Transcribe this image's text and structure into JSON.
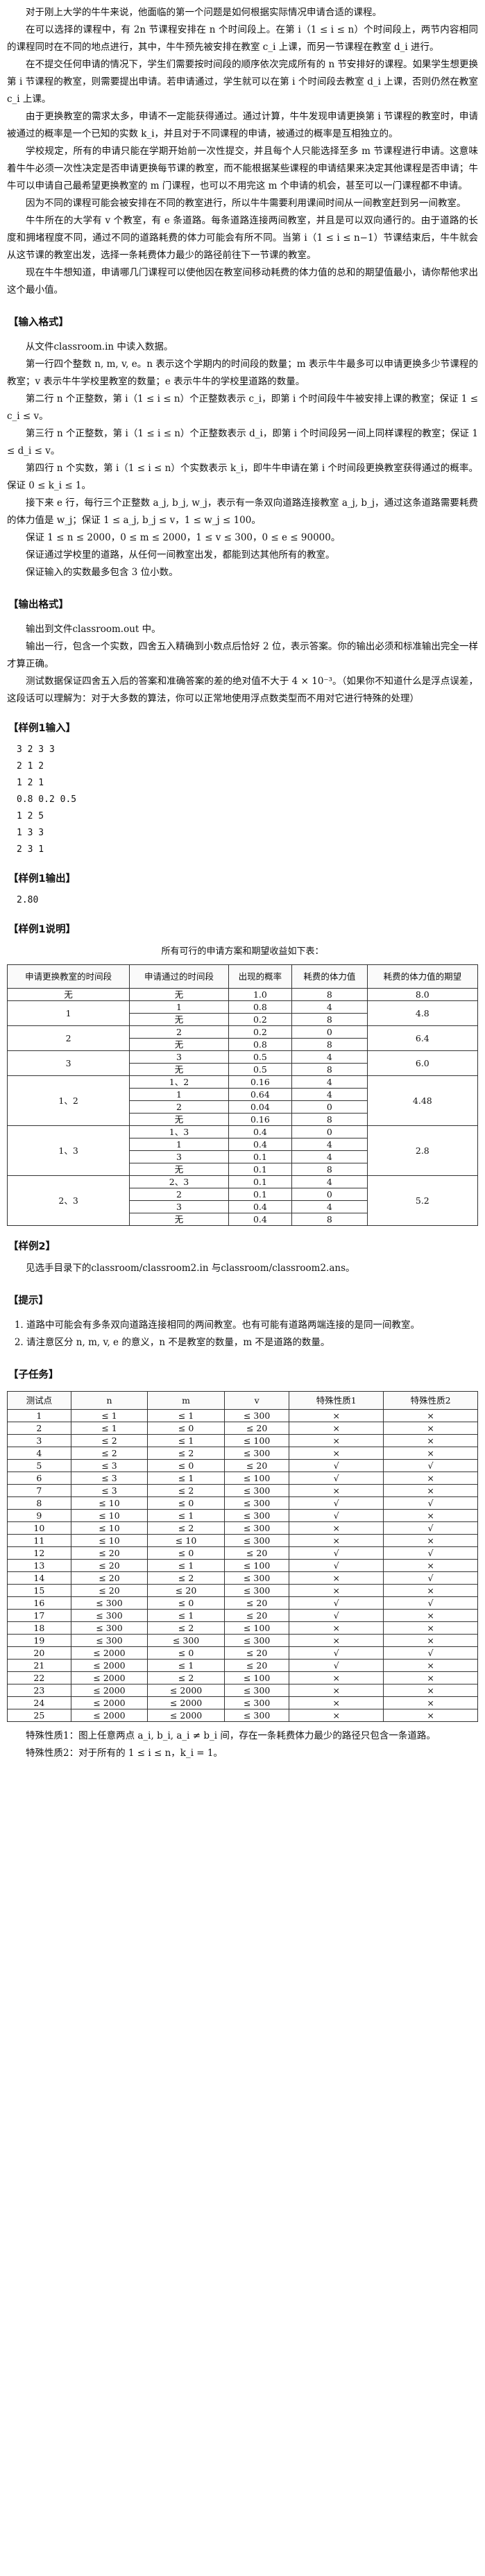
{
  "intro": [
    "对于刚上大学的牛牛来说，他面临的第一个问题是如何根据实际情况申请合适的课程。",
    "在可以选择的课程中，有 2n 节课程安排在 n 个时间段上。在第 i（1 ≤ i ≤ n）个时间段上，两节内容相同的课程同时在不同的地点进行，其中，牛牛预先被安排在教室 c_i 上课，而另一节课程在教室 d_i 进行。",
    "在不提交任何申请的情况下，学生们需要按时间段的顺序依次完成所有的 n 节安排好的课程。如果学生想更换第 i 节课程的教室，则需要提出申请。若申请通过，学生就可以在第 i 个时间段去教室 d_i 上课，否则仍然在教室 c_i 上课。",
    "由于更换教室的需求太多，申请不一定能获得通过。通过计算，牛牛发现申请更换第 i 节课程的教室时，申请被通过的概率是一个已知的实数 k_i，并且对于不同课程的申请，被通过的概率是互相独立的。",
    "学校规定，所有的申请只能在学期开始前一次性提交，并且每个人只能选择至多 m 节课程进行申请。这意味着牛牛必须一次性决定是否申请更换每节课的教室，而不能根据某些课程的申请结果来决定其他课程是否申请；牛牛可以申请自己最希望更换教室的 m 门课程，也可以不用完这 m 个申请的机会，甚至可以一门课程都不申请。",
    "因为不同的课程可能会被安排在不同的教室进行，所以牛牛需要利用课间时间从一间教室赶到另一间教室。",
    "牛牛所在的大学有 v 个教室，有 e 条道路。每条道路连接两间教室，并且是可以双向通行的。由于道路的长度和拥堵程度不同，通过不同的道路耗费的体力可能会有所不同。当第 i（1 ≤ i ≤ n−1）节课结束后，牛牛就会从这节课的教室出发，选择一条耗费体力最少的路径前往下一节课的教室。",
    "现在牛牛想知道，申请哪几门课程可以使他因在教室间移动耗费的体力值的总和的期望值最小，请你帮他求出这个最小值。"
  ],
  "input_format": {
    "title": "【输入格式】",
    "lines": [
      "从文件classroom.in 中读入数据。",
      "第一行四个整数 n, m, v, e。n 表示这个学期内的时间段的数量；m 表示牛牛最多可以申请更换多少节课程的教室；v 表示牛牛学校里教室的数量；e 表示牛牛的学校里道路的数量。",
      "第二行 n 个正整数，第 i（1 ≤ i ≤ n）个正整数表示 c_i，即第 i 个时间段牛牛被安排上课的教室；保证 1 ≤ c_i ≤ v。",
      "第三行 n 个正整数，第 i（1 ≤ i ≤ n）个正整数表示 d_i，即第 i 个时间段另一间上同样课程的教室；保证 1 ≤ d_i ≤ v。",
      "第四行 n 个实数，第 i（1 ≤ i ≤ n）个实数表示 k_i，即牛牛申请在第 i 个时间段更换教室获得通过的概率。保证 0 ≤ k_i ≤ 1。",
      "接下来 e 行，每行三个正整数 a_j, b_j, w_j，表示有一条双向道路连接教室 a_j, b_j，通过这条道路需要耗费的体力值是 w_j；保证 1 ≤ a_j, b_j ≤ v，1 ≤ w_j ≤ 100。",
      "保证 1 ≤ n ≤ 2000，0 ≤ m ≤ 2000，1 ≤ v ≤ 300，0 ≤ e ≤ 90000。",
      "保证通过学校里的道路，从任何一间教室出发，都能到达其他所有的教室。",
      "保证输入的实数最多包含 3 位小数。"
    ]
  },
  "output_format": {
    "title": "【输出格式】",
    "lines": [
      "输出到文件classroom.out 中。",
      "输出一行，包含一个实数，四舍五入精确到小数点后恰好 2 位，表示答案。你的输出必须和标准输出完全一样才算正确。",
      "测试数据保证四舍五入后的答案和准确答案的差的绝对值不大于 4 × 10⁻³。（如果你不知道什么是浮点误差，这段话可以理解为：对于大多数的算法，你可以正常地使用浮点数类型而不用对它进行特殊的处理）"
    ]
  },
  "sample1_input": {
    "title": "【样例1输入】",
    "lines": [
      "3 2 3 3",
      "2 1 2",
      "1 2 1",
      "0.8 0.2 0.5",
      "1 2 5",
      "1 3 3",
      "2 3 1"
    ]
  },
  "sample1_output": {
    "title": "【样例1输出】",
    "lines": [
      "2.80"
    ]
  },
  "sample1_explain": {
    "title": "【样例1说明】",
    "caption": "所有可行的申请方案和期望收益如下表：",
    "headers": [
      "申请更换教室的时间段",
      "申请通过的时间段",
      "出现的概率",
      "耗费的体力值",
      "耗费的体力值的期望"
    ],
    "groups": [
      {
        "apply": "无",
        "rows": [
          [
            "无",
            "1.0",
            "8"
          ]
        ],
        "expect": "8.0"
      },
      {
        "apply": "1",
        "rows": [
          [
            "1",
            "0.8",
            "4"
          ],
          [
            "无",
            "0.2",
            "8"
          ]
        ],
        "expect": "4.8"
      },
      {
        "apply": "2",
        "rows": [
          [
            "2",
            "0.2",
            "0"
          ],
          [
            "无",
            "0.8",
            "8"
          ]
        ],
        "expect": "6.4"
      },
      {
        "apply": "3",
        "rows": [
          [
            "3",
            "0.5",
            "4"
          ],
          [
            "无",
            "0.5",
            "8"
          ]
        ],
        "expect": "6.0"
      },
      {
        "apply": "1、2",
        "rows": [
          [
            "1、2",
            "0.16",
            "4"
          ],
          [
            "1",
            "0.64",
            "4"
          ],
          [
            "2",
            "0.04",
            "0"
          ],
          [
            "无",
            "0.16",
            "8"
          ]
        ],
        "expect": "4.48"
      },
      {
        "apply": "1、3",
        "rows": [
          [
            "1、3",
            "0.4",
            "0"
          ],
          [
            "1",
            "0.4",
            "4"
          ],
          [
            "3",
            "0.1",
            "4"
          ],
          [
            "无",
            "0.1",
            "8"
          ]
        ],
        "expect": "2.8"
      },
      {
        "apply": "2、3",
        "rows": [
          [
            "2、3",
            "0.1",
            "4"
          ],
          [
            "2",
            "0.1",
            "0"
          ],
          [
            "3",
            "0.4",
            "4"
          ],
          [
            "无",
            "0.4",
            "8"
          ]
        ],
        "expect": "5.2"
      }
    ]
  },
  "sample2": {
    "title": "【样例2】",
    "line": "见选手目录下的classroom/classroom2.in 与classroom/classroom2.ans。"
  },
  "hints": {
    "title": "【提示】",
    "items": [
      "道路中可能会有多条双向道路连接相同的两间教室。也有可能有道路两端连接的是同一间教室。",
      "请注意区分 n, m, v, e 的意义，n 不是教室的数量，m 不是道路的数量。"
    ]
  },
  "subtasks": {
    "title": "【子任务】",
    "headers": [
      "测试点",
      "n",
      "m",
      "v",
      "特殊性质1",
      "特殊性质2"
    ],
    "rows": [
      [
        "1",
        "≤ 1",
        "≤ 1",
        "≤ 300",
        "×",
        "×"
      ],
      [
        "2",
        "≤ 1",
        "≤ 0",
        "≤ 20",
        "×",
        "×"
      ],
      [
        "3",
        "≤ 2",
        "≤ 1",
        "≤ 100",
        "×",
        "×"
      ],
      [
        "4",
        "≤ 2",
        "≤ 2",
        "≤ 300",
        "×",
        "×"
      ],
      [
        "5",
        "≤ 3",
        "≤ 0",
        "≤ 20",
        "√",
        "√"
      ],
      [
        "6",
        "≤ 3",
        "≤ 1",
        "≤ 100",
        "√",
        "×"
      ],
      [
        "7",
        "≤ 3",
        "≤ 2",
        "≤ 300",
        "×",
        "×"
      ],
      [
        "8",
        "≤ 10",
        "≤ 0",
        "≤ 300",
        "√",
        "√"
      ],
      [
        "9",
        "≤ 10",
        "≤ 1",
        "≤ 300",
        "√",
        "×"
      ],
      [
        "10",
        "≤ 10",
        "≤ 2",
        "≤ 300",
        "×",
        "√"
      ],
      [
        "11",
        "≤ 10",
        "≤ 10",
        "≤ 300",
        "×",
        "×"
      ],
      [
        "12",
        "≤ 20",
        "≤ 0",
        "≤ 20",
        "√",
        "√"
      ],
      [
        "13",
        "≤ 20",
        "≤ 1",
        "≤ 100",
        "√",
        "×"
      ],
      [
        "14",
        "≤ 20",
        "≤ 2",
        "≤ 300",
        "×",
        "√"
      ],
      [
        "15",
        "≤ 20",
        "≤ 20",
        "≤ 300",
        "×",
        "×"
      ],
      [
        "16",
        "≤ 300",
        "≤ 0",
        "≤ 20",
        "√",
        "√"
      ],
      [
        "17",
        "≤ 300",
        "≤ 1",
        "≤ 20",
        "√",
        "×"
      ],
      [
        "18",
        "≤ 300",
        "≤ 2",
        "≤ 100",
        "×",
        "×"
      ],
      [
        "19",
        "≤ 300",
        "≤ 300",
        "≤ 300",
        "×",
        "×"
      ],
      [
        "20",
        "≤ 2000",
        "≤ 0",
        "≤ 20",
        "√",
        "√"
      ],
      [
        "21",
        "≤ 2000",
        "≤ 1",
        "≤ 20",
        "√",
        "×"
      ],
      [
        "22",
        "≤ 2000",
        "≤ 2",
        "≤ 100",
        "×",
        "×"
      ],
      [
        "23",
        "≤ 2000",
        "≤ 2000",
        "≤ 300",
        "×",
        "×"
      ],
      [
        "24",
        "≤ 2000",
        "≤ 2000",
        "≤ 300",
        "×",
        "×"
      ],
      [
        "25",
        "≤ 2000",
        "≤ 2000",
        "≤ 300",
        "×",
        "×"
      ]
    ]
  },
  "notes": [
    "特殊性质1：图上任意两点 a_i, b_i, a_i ≠ b_i 间，存在一条耗费体力最少的路径只包含一条道路。",
    "特殊性质2：对于所有的 1 ≤ i ≤ n，k_i = 1。"
  ]
}
